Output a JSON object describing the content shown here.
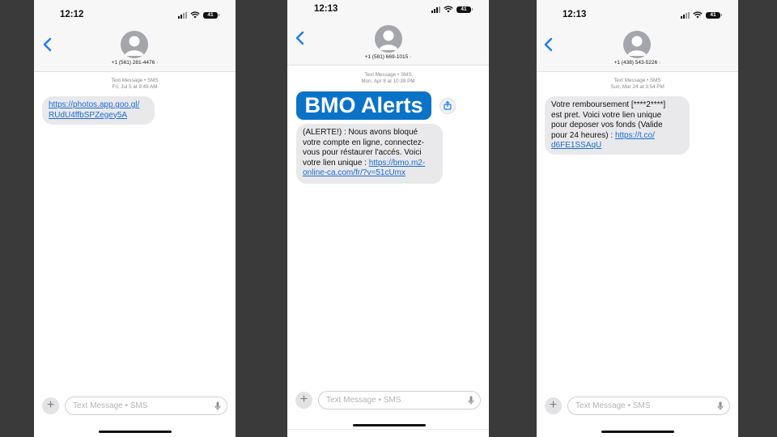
{
  "phones": [
    {
      "time": "12:12",
      "battery": "41",
      "contact": "+1 (561) 281-4476",
      "chevron": "›",
      "meta_line1": "Text Message • SMS",
      "meta_line2": "Fri, Jul 5 at 9:49 AM",
      "message": {
        "link": "https://photos.app.goo.gl/RUdU4ffbSPZegey5A"
      },
      "link_line1": "https://photos.app.goo.gl/",
      "link_line2": "RUdU4ffbSPZegey5A",
      "placeholder": "Text Message • SMS"
    },
    {
      "time": "12:13",
      "battery": "41",
      "contact": "+1 (581) 669-1015",
      "chevron": "›",
      "meta_line1": "Text Message • SMS",
      "meta_line2": "Mon, Apr 8 at 10:39 PM",
      "logo_text": "BMO Alerts",
      "message": {
        "text": "(ALERTE!) : Nous avons bloqué votre compte en ligne, connectez-vous pour réstaurer l'accés. Voici votre lien unique : ",
        "link": "https://bmo.m2-online-ca.com/fr/?v=51cUmx"
      },
      "text_line1": "(ALERTE!) : Nous avons bloqué",
      "text_line2": "votre compte en ligne, connectez-",
      "text_line3": "vous pour réstaurer l'accés. Voici",
      "text_line4": "votre lien unique : ",
      "link_line1": "https://bmo.m2-",
      "link_line2": "online-ca.com/fr/?v=51cUmx",
      "placeholder": "Text Message • SMS"
    },
    {
      "time": "12:13",
      "battery": "41",
      "contact": "+1 (438) 543-5226",
      "chevron": "›",
      "meta_line1": "Text Message • SMS",
      "meta_line2": "Sun, Mar 24 at 3:54 PM",
      "message": {
        "text": "Votre remboursement [****2****] est pret. Voici votre lien unique pour deposer vos fonds (Valide pour 24 heures) : ",
        "link": "https://t.co/d6FE1SSAqU"
      },
      "text_line1": "Votre remboursement [****2****]",
      "text_line2": "est pret. Voici votre lien unique",
      "text_line3": "pour deposer vos fonds (Valide",
      "text_line4": "pour 24 heures) : ",
      "link_line1": "https://t.co/",
      "link_line2": "d6FE1SSAqU",
      "placeholder": "Text Message • SMS"
    }
  ],
  "colors": {
    "background": "#3a3a3a",
    "bubble": "#e9e9eb",
    "link": "#1a6bd6",
    "ios_blue": "#1a7ef2",
    "bmo_blue": "#0a73c8"
  },
  "icons": [
    "chevron-left-icon",
    "avatar-icon",
    "signal-icon",
    "wifi-icon",
    "battery-icon",
    "plus-icon",
    "mic-icon",
    "share-icon"
  ]
}
